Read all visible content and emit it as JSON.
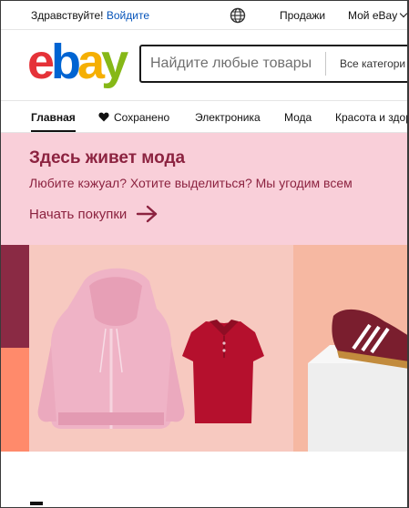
{
  "topbar": {
    "greeting": "Здравствуйте!",
    "signin_link": "Войдите",
    "sell": "Продажи",
    "my_ebay": "Мой eBay"
  },
  "header": {
    "logo_text": "ebay",
    "search_placeholder": "Найдите любые товары",
    "category_label": "Все категори"
  },
  "nav": {
    "home": "Главная",
    "saved": "Сохранено",
    "electronics": "Электроника",
    "fashion": "Мода",
    "beauty": "Красота и здор"
  },
  "promo": {
    "title": "Здесь живет мода",
    "subtitle": "Любите кэжуал? Хотите выделиться? Мы угодим всем",
    "cta": "Начать покупки"
  },
  "colors": {
    "promo_bg": "#f9cfd9",
    "promo_text": "#8c2340",
    "link_blue": "#0654ba",
    "logo_red": "#e53238",
    "logo_blue": "#0064d2",
    "logo_yellow": "#f5af02",
    "logo_green": "#86b817"
  },
  "icons": {
    "globe": "globe-icon",
    "chevron": "chevron-down-icon",
    "heart": "heart-icon",
    "arrow": "arrow-right-icon"
  }
}
